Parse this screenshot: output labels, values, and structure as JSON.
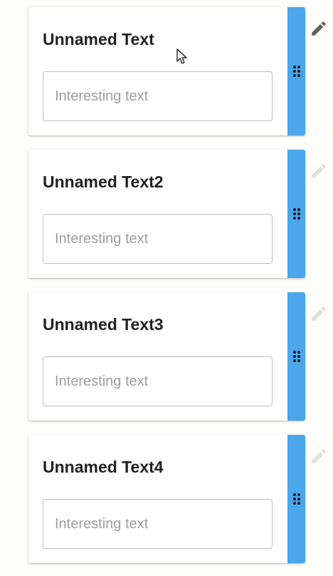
{
  "cards": [
    {
      "title": "Unnamed Text",
      "input_value": "",
      "input_placeholder": "Interesting text",
      "edit_state": "active"
    },
    {
      "title": "Unnamed Text2",
      "input_value": "",
      "input_placeholder": "Interesting text",
      "edit_state": "disabled"
    },
    {
      "title": "Unnamed Text3",
      "input_value": "",
      "input_placeholder": "Interesting text",
      "edit_state": "disabled"
    },
    {
      "title": "Unnamed Text4",
      "input_value": "",
      "input_placeholder": "Interesting text",
      "edit_state": "disabled"
    }
  ],
  "icons": {
    "drag": "drag-indicator-icon",
    "edit": "pencil-icon"
  },
  "colors": {
    "handle": "#4ba6ec",
    "edit_active": "#616161",
    "edit_disabled": "#e0e0e0",
    "title": "#222222",
    "placeholder": "#9e9e9e"
  }
}
